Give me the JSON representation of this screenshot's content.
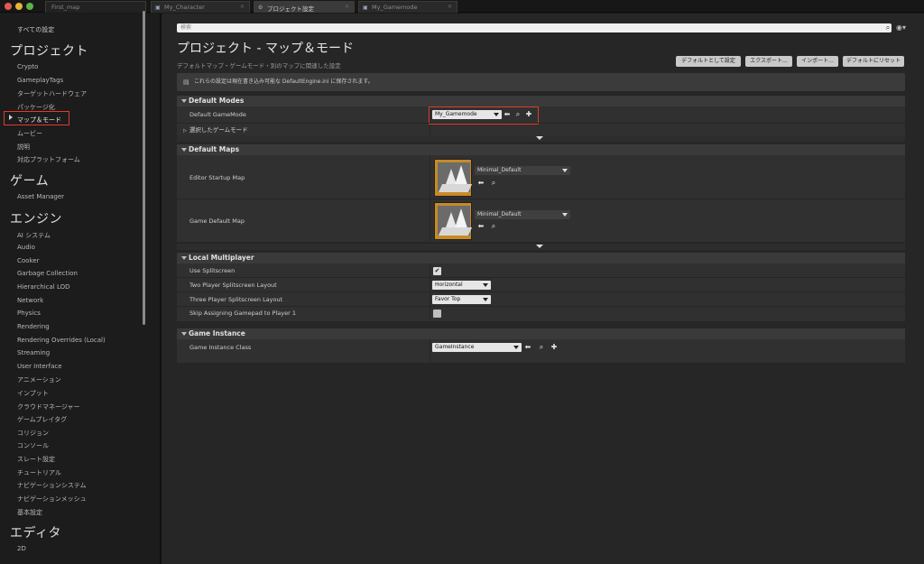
{
  "tabs": [
    {
      "label": "First_map",
      "icon": "map-icon"
    },
    {
      "label": "My_Character",
      "icon": "blueprint-icon"
    },
    {
      "label": "プロジェクト設定",
      "icon": "gear-icon"
    },
    {
      "label": "My_Gamemode",
      "icon": "blueprint-icon"
    }
  ],
  "sidebar": {
    "all_settings": "すべての設定",
    "categories": {
      "project": "プロジェクト",
      "game": "ゲーム",
      "engine": "エンジン",
      "editor": "エディタ"
    },
    "project_items": [
      "Crypto",
      "GameplayTags",
      "ターゲットハードウェア",
      "パッケージ化",
      "マップ＆モード",
      "ムービー",
      "説明",
      "対応プラットフォーム"
    ],
    "game_items": [
      "Asset Manager"
    ],
    "engine_items": [
      "AI システム",
      "Audio",
      "Cooker",
      "Garbage Collection",
      "Hierarchical LOD",
      "Network",
      "Physics",
      "Rendering",
      "Rendering Overrides (Local)",
      "Streaming",
      "User Interface",
      "アニメーション",
      "インプット",
      "クラウドマネージャー",
      "ゲームプレイタグ",
      "コリジョン",
      "コンソール",
      "スレート設定",
      "チュートリアル",
      "ナビゲーションシステム",
      "ナビゲーションメッシュ",
      "基本設定"
    ],
    "editor_items": [
      "2D"
    ],
    "selected": "マップ＆モード"
  },
  "search": {
    "placeholder": "検索"
  },
  "header": {
    "title": "プロジェクト - マップ＆モード",
    "subtitle": "デフォルトマップ・ゲームモード・別のマップに関連した設定",
    "buttons": {
      "set_default": "デフォルトとして設定",
      "export": "エクスポート...",
      "import": "インポート...",
      "reset": "デフォルトにリセット"
    }
  },
  "notice": "これらの設定は現在書き込み可能な DefaultEngine.ini に保存されます。",
  "sections": {
    "default_modes": {
      "title": "Default Modes",
      "default_gamemode_label": "Default GameMode",
      "default_gamemode_value": "My_Gamemode",
      "selected_gamemode_label": "選択したゲームモード"
    },
    "default_maps": {
      "title": "Default Maps",
      "editor_startup_label": "Editor Startup Map",
      "editor_startup_value": "Minimal_Default",
      "game_default_label": "Game Default Map",
      "game_default_value": "Minimal_Default"
    },
    "local_multiplayer": {
      "title": "Local Multiplayer",
      "use_splitscreen_label": "Use Splitscreen",
      "use_splitscreen_checked": true,
      "two_player_label": "Two Player Splitscreen Layout",
      "two_player_value": "Horizontal",
      "three_player_label": "Three Player Splitscreen Layout",
      "three_player_value": "Favor Top",
      "skip_gamepad_label": "Skip Assigning Gamepad to Player 1",
      "skip_gamepad_checked": false
    },
    "game_instance": {
      "title": "Game Instance",
      "class_label": "Game Instance Class",
      "class_value": "GameInstance"
    }
  },
  "colors": {
    "highlight": "#e03a2c",
    "thumbnail": "#c98a24"
  }
}
